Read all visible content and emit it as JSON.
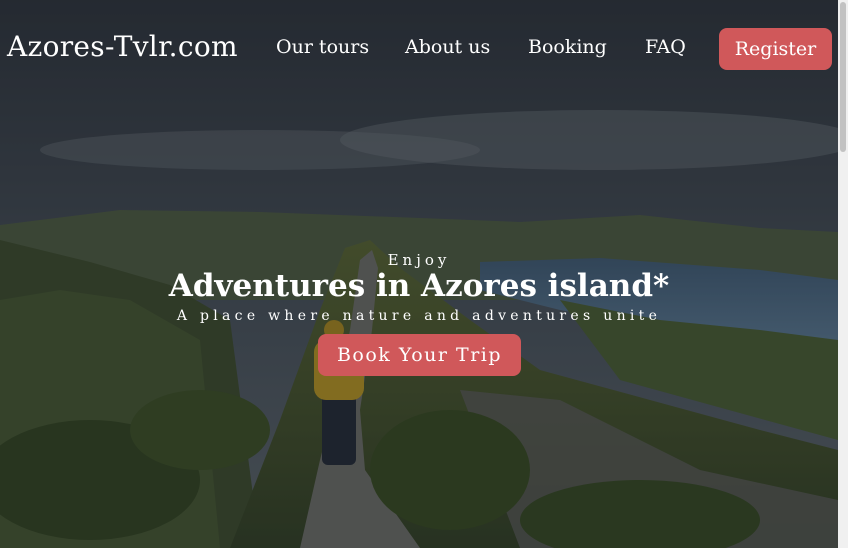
{
  "brand": "Azores-Tvlr.com",
  "nav": {
    "items": [
      "Our tours",
      "About us",
      "Booking",
      "FAQ"
    ],
    "register": "Register"
  },
  "hero": {
    "kicker": "Enjoy",
    "title": "Adventures in Azores island*",
    "tagline": "A place where nature and adventures unite",
    "cta": "Book Your Trip"
  },
  "colors": {
    "accent": "#d0585a",
    "overlay": "#1e232b"
  }
}
